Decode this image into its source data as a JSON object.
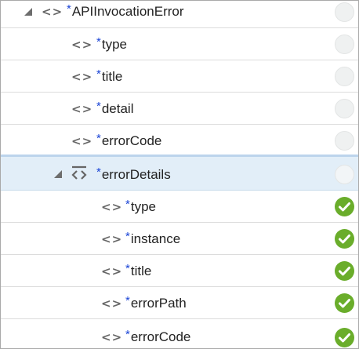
{
  "tree": {
    "nodes": [
      {
        "required_mark": "*",
        "label": "APIInvocationError",
        "status": "empty",
        "expanded": true
      },
      {
        "required_mark": "*",
        "label": "type",
        "status": "empty"
      },
      {
        "required_mark": "*",
        "label": "title",
        "status": "empty"
      },
      {
        "required_mark": "*",
        "label": "detail",
        "status": "empty"
      },
      {
        "required_mark": "*",
        "label": "errorCode",
        "status": "empty"
      },
      {
        "required_mark": "*",
        "label": "errorDetails",
        "status": "empty",
        "expanded": true,
        "selected": true
      },
      {
        "required_mark": "*",
        "label": "type",
        "status": "mapped"
      },
      {
        "required_mark": "*",
        "label": "instance",
        "status": "mapped"
      },
      {
        "required_mark": "*",
        "label": "title",
        "status": "mapped"
      },
      {
        "required_mark": "*",
        "label": "errorPath",
        "status": "mapped"
      },
      {
        "required_mark": "*",
        "label": "errorCode",
        "status": "mapped"
      }
    ]
  },
  "icons": {
    "element": "element-icon",
    "repeating_group": "repeating-element-icon",
    "expander": "collapse-triangle-icon",
    "status_empty": "empty-status-circle-icon",
    "status_mapped": "checkmark-circle-icon"
  },
  "colors": {
    "required_mark": "#1a44d6",
    "selected_row": "#e2eef8",
    "mapped_status": "#6aad2b",
    "empty_status": "#eff1f1"
  }
}
